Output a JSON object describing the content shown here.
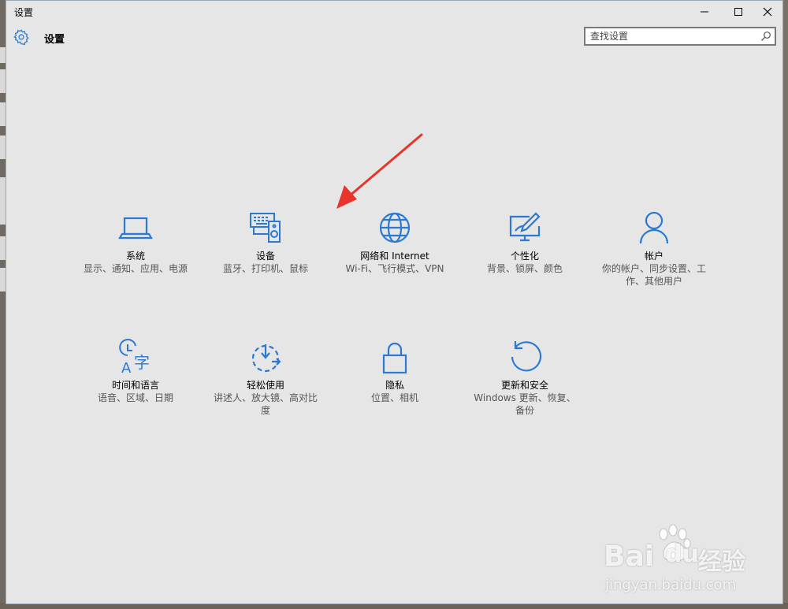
{
  "window": {
    "title": "设置",
    "minimize_icon": "minimize-icon",
    "maximize_icon": "maximize-icon",
    "close_icon": "close-icon"
  },
  "header": {
    "title": "设置",
    "icon": "gear-icon"
  },
  "search": {
    "placeholder": "查找设置",
    "icon": "search-icon"
  },
  "tiles": [
    {
      "label": "系统",
      "desc": "显示、通知、应用、电源",
      "icon": "laptop-icon"
    },
    {
      "label": "设备",
      "desc": "蓝牙、打印机、鼠标",
      "icon": "devices-icon"
    },
    {
      "label": "网络和 Internet",
      "desc": "Wi-Fi、飞行模式、VPN",
      "icon": "globe-icon"
    },
    {
      "label": "个性化",
      "desc": "背景、锁屏、颜色",
      "icon": "personalization-icon"
    },
    {
      "label": "帐户",
      "desc": "你的帐户、同步设置、工作、其他用户",
      "icon": "person-icon"
    },
    {
      "label": "时间和语言",
      "desc": "语音、区域、日期",
      "icon": "time-language-icon"
    },
    {
      "label": "轻松使用",
      "desc": "讲述人、放大镜、高对比度",
      "icon": "ease-of-access-icon"
    },
    {
      "label": "隐私",
      "desc": "位置、相机",
      "icon": "lock-icon"
    },
    {
      "label": "更新和安全",
      "desc": "Windows 更新、恢复、备份",
      "icon": "update-icon"
    }
  ],
  "accent_color": "#2b79d1",
  "watermark": {
    "brand": "Bai",
    "brand2": "du",
    "brand_cn": "经验",
    "url": "jingyan.baidu.com"
  }
}
